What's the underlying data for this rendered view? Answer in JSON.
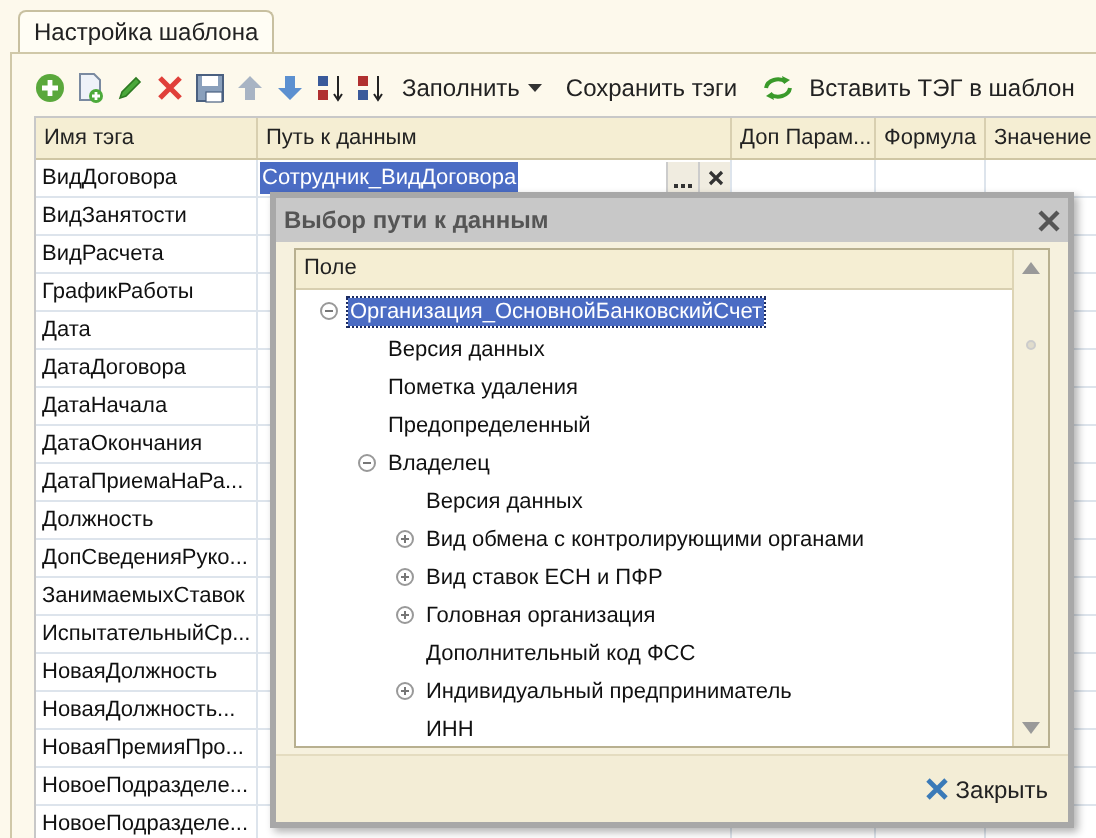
{
  "tab": {
    "label": "Настройка шаблона",
    "selected": true
  },
  "toolbar": {
    "actions": [
      {
        "kind": "menu",
        "label": "Заполнить"
      },
      {
        "kind": "text",
        "label": "Сохранить тэги"
      },
      {
        "kind": "refresh",
        "label": "Вставить ТЭГ в шаблон"
      }
    ]
  },
  "table": {
    "columns": [
      "Имя тэга",
      "Путь к данным",
      "Доп Парам...",
      "Формула",
      "Значение"
    ],
    "rows": [
      {
        "tag": "ВидДоговора",
        "path": "Сотрудник_ВидДоговора"
      },
      {
        "tag": "ВидЗанятости"
      },
      {
        "tag": "ВидРасчета"
      },
      {
        "tag": "ГрафикРаботы"
      },
      {
        "tag": "Дата"
      },
      {
        "tag": "ДатаДоговора"
      },
      {
        "tag": "ДатаНачала"
      },
      {
        "tag": "ДатаОкончания"
      },
      {
        "tag": "ДатаПриемаНаРа..."
      },
      {
        "tag": "Должность"
      },
      {
        "tag": "ДопСведенияРуко..."
      },
      {
        "tag": "ЗанимаемыхСтавок"
      },
      {
        "tag": "ИспытательныйСр..."
      },
      {
        "tag": "НоваяДолжность"
      },
      {
        "tag": "НоваяДолжность..."
      },
      {
        "tag": "НоваяПремияПро..."
      },
      {
        "tag": "НовоеПодразделе..."
      },
      {
        "tag": "НовоеПодразделе..."
      }
    ]
  },
  "dialog": {
    "title": "Выбор пути к данным",
    "column": "Поле",
    "tree": [
      {
        "label": "Организация_ОсновнойБанковскийСчет",
        "expanded": true,
        "selected": true,
        "children": [
          {
            "label": "Версия данных",
            "selected": false
          },
          {
            "label": "Пометка удаления",
            "selected": false
          },
          {
            "label": "Предопределенный",
            "selected": false
          },
          {
            "label": "Владелец",
            "expanded": true,
            "selected": false,
            "children": [
              {
                "label": "Версия данных",
                "selected": false
              },
              {
                "label": "Вид обмена с контролирующими органами",
                "expanded": false,
                "selected": false
              },
              {
                "label": "Вид ставок ЕСН и ПФР",
                "expanded": false,
                "selected": false
              },
              {
                "label": "Головная организация",
                "expanded": false,
                "selected": false
              },
              {
                "label": "Дополнительный код ФСС",
                "selected": false
              },
              {
                "label": "Индивидуальный предприниматель",
                "expanded": false,
                "selected": false
              },
              {
                "label": "ИНН",
                "selected": false
              }
            ]
          }
        ]
      }
    ],
    "close_button": "Закрыть"
  }
}
